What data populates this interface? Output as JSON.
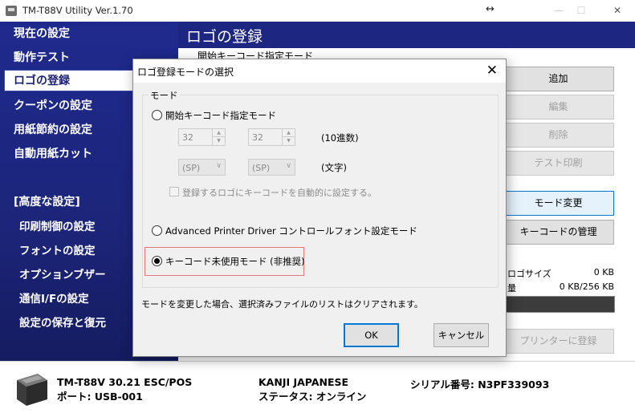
{
  "window": {
    "title": "TM-T88V Utility Ver.1.70",
    "resize_glyph": "↔",
    "minimize": "—",
    "maximize": "☐",
    "close": "✕"
  },
  "sidebar": {
    "items": [
      {
        "label": "現在の設定"
      },
      {
        "label": "動作テスト"
      },
      {
        "label": "ロゴの登録"
      },
      {
        "label": "クーポンの設定"
      },
      {
        "label": "用紙節約の設定"
      },
      {
        "label": "自動用紙カット"
      }
    ],
    "advanced_heading": "[高度な設定]",
    "advanced_items": [
      {
        "label": "印刷制御の設定"
      },
      {
        "label": "フォントの設定"
      },
      {
        "label": "オプションブザー"
      },
      {
        "label": "通信I/Fの設定"
      },
      {
        "label": "設定の保存と復元"
      }
    ]
  },
  "main": {
    "title": "ロゴの登録",
    "subtitle": "開始キーコード指定モード",
    "buttons": {
      "add": "追加",
      "edit": "編集",
      "delete": "削除",
      "test_print": "テスト印刷",
      "mode_change": "モード変更",
      "keycode_manage": "キーコードの管理",
      "register": "プリンターに登録"
    },
    "logo_size_label": "ロゴサイズ",
    "logo_size_value": "0 KB",
    "capacity_label": "量",
    "capacity_value": "0 KB/256 KB"
  },
  "status": {
    "model": "TM-T88V 30.21 ESC/POS",
    "port": "ポート: USB-001",
    "font": "KANJI JAPANESE",
    "state": "ステータス: オンライン",
    "serial": "シリアル番号: N3PF339093"
  },
  "dialog": {
    "title": "ロゴ登録モードの選択",
    "close": "✕",
    "group_label": "モード",
    "option_start_keycode": "開始キーコード指定モード",
    "spin1_value": "32",
    "spin2_value": "32",
    "unit_decimal": "(10進数)",
    "combo1_value": "(SP)",
    "combo2_value": "(SP)",
    "unit_char": "(文字)",
    "auto_keycode_check": "登録するロゴにキーコードを自動的に設定する。",
    "option_apd": "Advanced Printer Driver コントロールフォント設定モード",
    "option_unused": "キーコード未使用モード (非推奨)",
    "note": "モードを変更した場合、選択済みファイルのリストはクリアされます。",
    "ok": "OK",
    "cancel": "キャンセル"
  }
}
